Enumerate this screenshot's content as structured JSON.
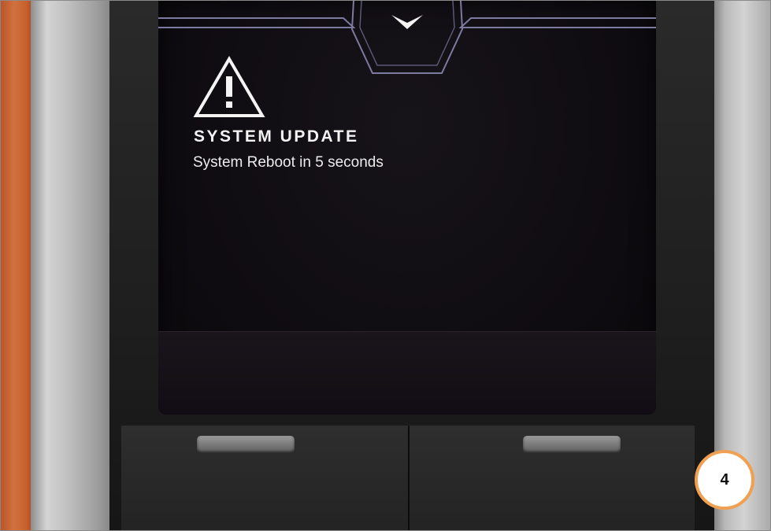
{
  "alert": {
    "title": "SYSTEM UPDATE",
    "message": "System Reboot in 5 seconds",
    "icon": "warning-triangle-icon"
  },
  "hud": {
    "expand_icon": "chevron-down-icon"
  },
  "step_badge": {
    "number": "4",
    "border_color": "#f0a050"
  },
  "colors": {
    "screen_bg": "#100d12",
    "hud_line": "#8c8ab0",
    "text": "#f2f2f2",
    "leather": "#c8622f"
  }
}
